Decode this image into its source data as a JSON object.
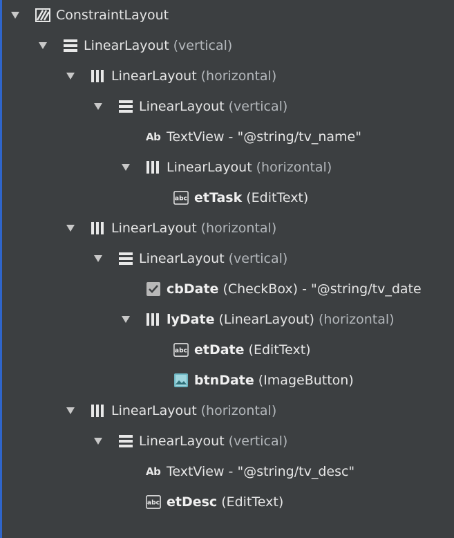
{
  "tree": [
    {
      "depth": 0,
      "arrow": true,
      "icon": "constraint-layout-icon",
      "name": "ConstraintLayout",
      "bold": false,
      "detail": "",
      "hint": ""
    },
    {
      "depth": 1,
      "arrow": true,
      "icon": "linear-vertical-icon",
      "name": "LinearLayout",
      "bold": false,
      "detail": "",
      "hint": "(vertical)"
    },
    {
      "depth": 2,
      "arrow": true,
      "icon": "linear-horizontal-icon",
      "name": "LinearLayout",
      "bold": false,
      "detail": "",
      "hint": "(horizontal)"
    },
    {
      "depth": 3,
      "arrow": true,
      "icon": "linear-vertical-icon",
      "name": "LinearLayout",
      "bold": false,
      "detail": "",
      "hint": "(vertical)"
    },
    {
      "depth": 4,
      "arrow": false,
      "icon": "textview-icon",
      "name": "TextView - \"@string/tv_name\"",
      "bold": false,
      "detail": "",
      "hint": ""
    },
    {
      "depth": 4,
      "arrow": true,
      "icon": "linear-horizontal-icon",
      "name": "LinearLayout",
      "bold": false,
      "detail": "",
      "hint": "(horizontal)"
    },
    {
      "depth": 5,
      "arrow": false,
      "icon": "edittext-icon",
      "name": "etTask",
      "bold": true,
      "detail": "(EditText)",
      "hint": ""
    },
    {
      "depth": 2,
      "arrow": true,
      "icon": "linear-horizontal-icon",
      "name": "LinearLayout",
      "bold": false,
      "detail": "",
      "hint": "(horizontal)"
    },
    {
      "depth": 3,
      "arrow": true,
      "icon": "linear-vertical-icon",
      "name": "LinearLayout",
      "bold": false,
      "detail": "",
      "hint": "(vertical)"
    },
    {
      "depth": 4,
      "arrow": false,
      "icon": "checkbox-icon",
      "name": "cbDate",
      "bold": true,
      "detail": "(CheckBox) - \"@string/tv_date",
      "hint": ""
    },
    {
      "depth": 4,
      "arrow": true,
      "icon": "linear-horizontal-icon",
      "name": "lyDate",
      "bold": true,
      "detail": "(LinearLayout)",
      "hint": "(horizontal)"
    },
    {
      "depth": 5,
      "arrow": false,
      "icon": "edittext-icon",
      "name": "etDate",
      "bold": true,
      "detail": "(EditText)",
      "hint": ""
    },
    {
      "depth": 5,
      "arrow": false,
      "icon": "imagebutton-icon",
      "name": "btnDate",
      "bold": true,
      "detail": "(ImageButton)",
      "hint": ""
    },
    {
      "depth": 2,
      "arrow": true,
      "icon": "linear-horizontal-icon",
      "name": "LinearLayout",
      "bold": false,
      "detail": "",
      "hint": "(horizontal)"
    },
    {
      "depth": 3,
      "arrow": true,
      "icon": "linear-vertical-icon",
      "name": "LinearLayout",
      "bold": false,
      "detail": "",
      "hint": "(vertical)"
    },
    {
      "depth": 4,
      "arrow": false,
      "icon": "textview-icon",
      "name": "TextView - \"@string/tv_desc\"",
      "bold": false,
      "detail": "",
      "hint": ""
    },
    {
      "depth": 4,
      "arrow": false,
      "icon": "edittext-icon",
      "name": "etDesc",
      "bold": true,
      "detail": "(EditText)",
      "hint": ""
    }
  ]
}
